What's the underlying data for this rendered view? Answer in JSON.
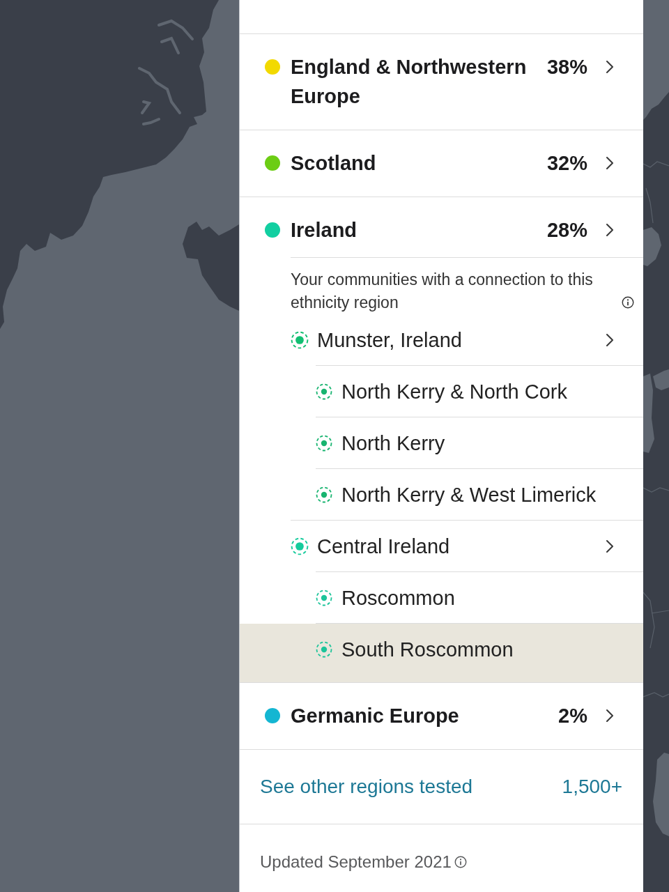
{
  "regions": [
    {
      "name": "England & Northwestern Europe",
      "percentage": "38%",
      "color": "#f2d900"
    },
    {
      "name": "Scotland",
      "percentage": "32%",
      "color": "#6ccd14"
    },
    {
      "name": "Ireland",
      "percentage": "28%",
      "color": "#12cfa1",
      "communities_note": "Your communities with a connection to this ethnicity region",
      "communities": [
        {
          "name": "Munster, Ireland",
          "color": "#12bf72",
          "selected": false,
          "children": [
            {
              "name": "North Kerry & North Cork",
              "color": "#18b470",
              "selected": false
            },
            {
              "name": "North Kerry",
              "color": "#18b470",
              "selected": false
            },
            {
              "name": "North Kerry & West Limerick",
              "color": "#18b470",
              "selected": false
            }
          ]
        },
        {
          "name": "Central Ireland",
          "color": "#16cb9c",
          "selected": false,
          "children": [
            {
              "name": "Roscommon",
              "color": "#1cc49a",
              "selected": false
            },
            {
              "name": "South Roscommon",
              "color": "#1cc49a",
              "selected": true
            }
          ]
        }
      ]
    },
    {
      "name": "Germanic Europe",
      "percentage": "2%",
      "color": "#14b6d2"
    }
  ],
  "other_regions": {
    "label": "See other regions tested",
    "count": "1,500+"
  },
  "updated": "Updated September 2021"
}
